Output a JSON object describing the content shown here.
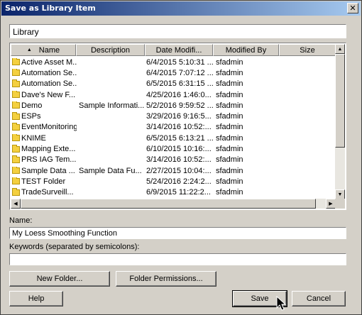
{
  "window": {
    "title": "Save as Library Item",
    "close_glyph": "✕"
  },
  "path": {
    "value": "Library"
  },
  "list": {
    "columns": [
      "Name",
      "Description",
      "Date Modifi...",
      "Modified By",
      "Size"
    ],
    "sort_indicator": "▲",
    "rows": [
      {
        "name": "Active Asset M...",
        "description": "",
        "date": "6/4/2015 5:10:31 ...",
        "modified_by": "sfadmin",
        "size": ""
      },
      {
        "name": "Automation Se...",
        "description": "",
        "date": "6/4/2015 7:07:12 ...",
        "modified_by": "sfadmin",
        "size": ""
      },
      {
        "name": "Automation Se...",
        "description": "",
        "date": "6/5/2015 6:31:15 ...",
        "modified_by": "sfadmin",
        "size": ""
      },
      {
        "name": "Dave's New F...",
        "description": "",
        "date": "4/25/2016 1:46:0...",
        "modified_by": "sfadmin",
        "size": ""
      },
      {
        "name": "Demo",
        "description": "Sample Informati...",
        "date": "5/2/2016 9:59:52 ...",
        "modified_by": "sfadmin",
        "size": ""
      },
      {
        "name": "ESPs",
        "description": "",
        "date": "3/29/2016 9:16:5...",
        "modified_by": "sfadmin",
        "size": ""
      },
      {
        "name": "EventMonitoring",
        "description": "",
        "date": "3/14/2016 10:52:...",
        "modified_by": "sfadmin",
        "size": ""
      },
      {
        "name": "KNIME",
        "description": "",
        "date": "6/5/2015 6:13:21 ...",
        "modified_by": "sfadmin",
        "size": ""
      },
      {
        "name": "Mapping Exte...",
        "description": "",
        "date": "6/10/2015 10:16:...",
        "modified_by": "sfadmin",
        "size": ""
      },
      {
        "name": "PRS IAG Tem...",
        "description": "",
        "date": "3/14/2016 10:52:...",
        "modified_by": "sfadmin",
        "size": ""
      },
      {
        "name": "Sample Data ...",
        "description": "Sample Data Fu...",
        "date": "2/27/2015 10:04:...",
        "modified_by": "sfadmin",
        "size": ""
      },
      {
        "name": "TEST Folder",
        "description": "",
        "date": "5/24/2016 2:24:2...",
        "modified_by": "sfadmin",
        "size": ""
      },
      {
        "name": "TradeSurveill...",
        "description": "",
        "date": "6/9/2015 11:22:2...",
        "modified_by": "sfadmin",
        "size": ""
      }
    ],
    "scroll_up_glyph": "▲",
    "scroll_down_glyph": "▼",
    "scroll_left_glyph": "◀",
    "scroll_right_glyph": "▶"
  },
  "name_field": {
    "label": "Name:",
    "value": "My Loess Smoothing Function"
  },
  "keywords_field": {
    "label": "Keywords (separated by semicolons):",
    "value": ""
  },
  "buttons": {
    "new_folder": "New Folder...",
    "folder_permissions": "Folder Permissions...",
    "help": "Help",
    "save": "Save",
    "cancel": "Cancel"
  },
  "icons": {
    "folder": "folder-icon",
    "close": "close-icon",
    "cursor": "mouse-pointer-icon"
  },
  "colors": {
    "dialog_bg": "#d4d0c8",
    "title_gradient_start": "#0a246a",
    "title_gradient_end": "#a6caf0",
    "folder_yellow": "#f4d03f"
  }
}
